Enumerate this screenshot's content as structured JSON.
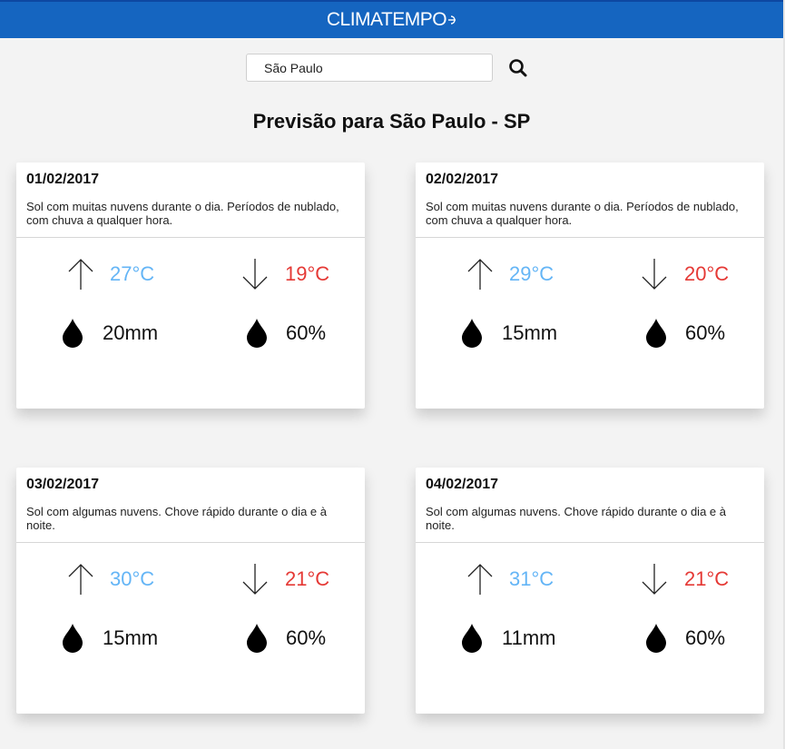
{
  "header": {
    "logo_text": "CLIMATEMPO",
    "bar_color": "#1565c0"
  },
  "search": {
    "value": "São Paulo",
    "button_icon": "search-icon"
  },
  "title": "Previsão para São Paulo - SP",
  "colors": {
    "max_temp": "#64b5f6",
    "min_temp": "#e53935"
  },
  "forecast": [
    {
      "date": "01/02/2017",
      "description": "Sol com muitas nuvens durante o dia. Períodos de nublado, com chuva a qualquer hora.",
      "max": "27°C",
      "min": "19°C",
      "rain": "20mm",
      "humidity": "60%"
    },
    {
      "date": "02/02/2017",
      "description": "Sol com muitas nuvens durante o dia. Períodos de nublado, com chuva a qualquer hora.",
      "max": "29°C",
      "min": "20°C",
      "rain": "15mm",
      "humidity": "60%"
    },
    {
      "date": "03/02/2017",
      "description": "Sol com algumas nuvens. Chove rápido durante o dia e à noite.",
      "max": "30°C",
      "min": "21°C",
      "rain": "15mm",
      "humidity": "60%"
    },
    {
      "date": "04/02/2017",
      "description": "Sol com algumas nuvens. Chove rápido durante o dia e à noite.",
      "max": "31°C",
      "min": "21°C",
      "rain": "11mm",
      "humidity": "60%"
    }
  ]
}
